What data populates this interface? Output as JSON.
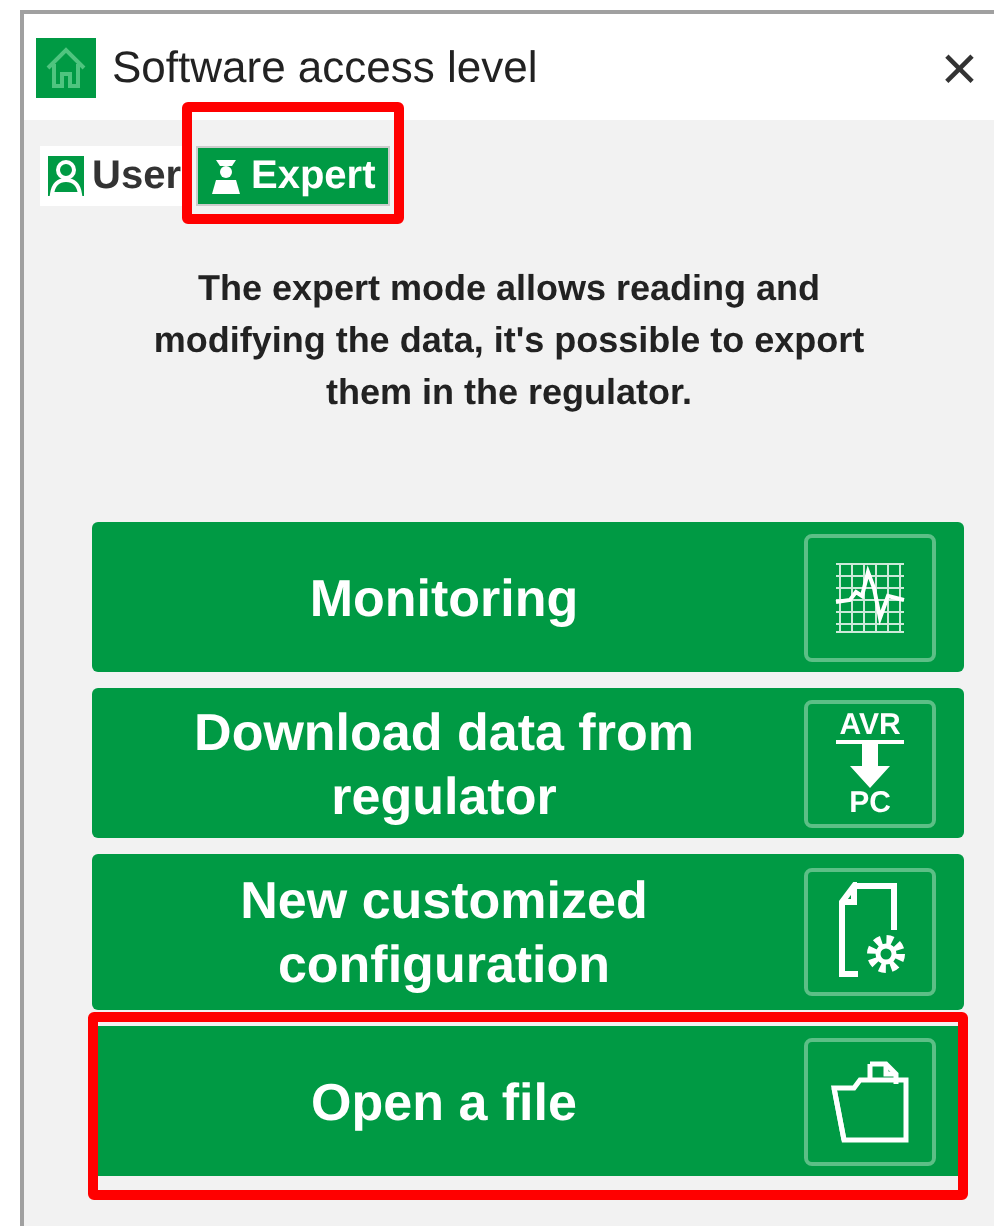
{
  "window": {
    "title": "Software access level",
    "close": "×"
  },
  "tabs": [
    {
      "label": "User",
      "selected": false
    },
    {
      "label": "Expert",
      "selected": true
    }
  ],
  "description": "The expert mode allows reading and modifying the data, it's possible to export them in the regulator.",
  "actions": [
    {
      "label": "Monitoring",
      "kind": "chart",
      "highlighted": false
    },
    {
      "label": "Download data from regulator",
      "kind": "download",
      "icon_top": "AVR",
      "icon_bottom": "PC",
      "highlighted": false
    },
    {
      "label": "New customized configuration",
      "kind": "config",
      "highlighted": false
    },
    {
      "label": "Open a file",
      "kind": "folder",
      "highlighted": true
    }
  ]
}
